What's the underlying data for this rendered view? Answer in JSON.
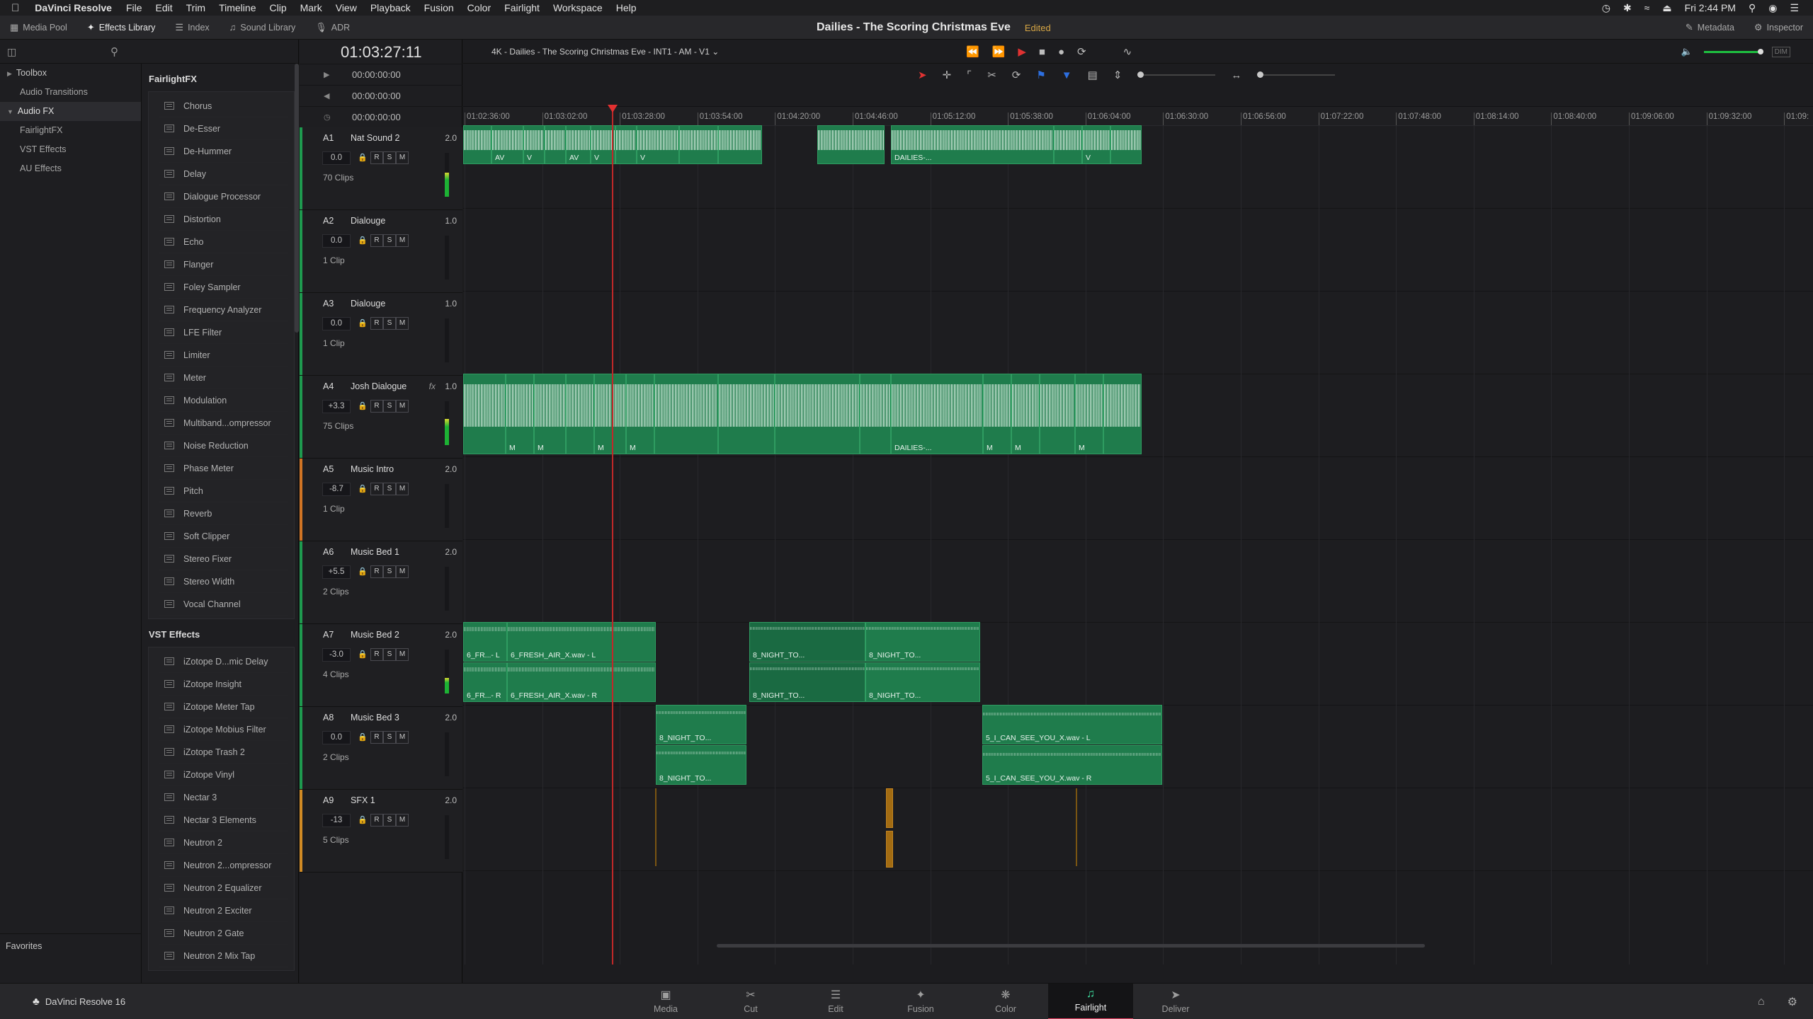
{
  "menubar": {
    "app_name": "DaVinci Resolve",
    "items": [
      "File",
      "Edit",
      "Trim",
      "Timeline",
      "Clip",
      "Mark",
      "View",
      "Playback",
      "Fusion",
      "Color",
      "Fairlight",
      "Workspace",
      "Help"
    ],
    "clock": "Fri 2:44 PM"
  },
  "topbar": {
    "media_pool": "Media Pool",
    "effects_library": "Effects Library",
    "index": "Index",
    "sound_library": "Sound Library",
    "adr": "ADR",
    "project_name": "Dailies - The Scoring Christmas Eve",
    "status": "Edited",
    "metadata": "Metadata",
    "inspector": "Inspector"
  },
  "tree": {
    "toolbox": "Toolbox",
    "audio_transitions": "Audio Transitions",
    "audio_fx": "Audio FX",
    "fairlight_fx": "FairlightFX",
    "vst_effects": "VST Effects",
    "au_effects": "AU Effects",
    "favorites": "Favorites"
  },
  "fairlight_section": "FairlightFX",
  "fairlight_fx": [
    "Chorus",
    "De-Esser",
    "De-Hummer",
    "Delay",
    "Dialogue Processor",
    "Distortion",
    "Echo",
    "Flanger",
    "Foley Sampler",
    "Frequency Analyzer",
    "LFE Filter",
    "Limiter",
    "Meter",
    "Modulation",
    "Multiband...ompressor",
    "Noise Reduction",
    "Phase Meter",
    "Pitch",
    "Reverb",
    "Soft Clipper",
    "Stereo Fixer",
    "Stereo Width",
    "Vocal Channel"
  ],
  "vst_section": "VST Effects",
  "vst_fx": [
    "iZotope D...mic Delay",
    "iZotope Insight",
    "iZotope Meter Tap",
    "iZotope Mobius Filter",
    "iZotope Trash 2",
    "iZotope Vinyl",
    "Nectar 3",
    "Nectar 3 Elements",
    "Neutron 2",
    "Neutron 2...ompressor",
    "Neutron 2 Equalizer",
    "Neutron 2 Exciter",
    "Neutron 2 Gate",
    "Neutron 2 Mix Tap"
  ],
  "timecode": {
    "current": "01:03:27:11",
    "in": "00:00:00:00",
    "out": "00:00:00:00",
    "duration": "00:00:00:00"
  },
  "timeline": {
    "title": "4K - Dailies - The Scoring Christmas Eve - INT1 - AM - V1",
    "ruler": [
      "01:02:36:00",
      "01:03:02:00",
      "01:03:28:00",
      "01:03:54:00",
      "01:04:20:00",
      "01:04:46:00",
      "01:05:12:00",
      "01:05:38:00",
      "01:06:04:00",
      "01:06:30:00",
      "01:06:56:00",
      "01:07:22:00",
      "01:07:48:00",
      "01:08:14:00",
      "01:08:40:00",
      "01:09:06:00",
      "01:09:32:00",
      "01:09:"
    ]
  },
  "tracks": [
    {
      "id": "A1",
      "name": "Nat Sound 2",
      "chan": "2.0",
      "vol": "0.0",
      "clips": "70 Clips",
      "fx": "",
      "color": "#1e9a4f",
      "meter": 0.55
    },
    {
      "id": "A2",
      "name": "Dialouge",
      "chan": "1.0",
      "vol": "0.0",
      "clips": "1 Clip",
      "fx": "",
      "color": "#1e9a4f",
      "meter": 0
    },
    {
      "id": "A3",
      "name": "Dialouge",
      "chan": "1.0",
      "vol": "0.0",
      "clips": "1 Clip",
      "fx": "",
      "color": "#1e9a4f",
      "meter": 0
    },
    {
      "id": "A4",
      "name": "Josh Dialogue",
      "chan": "1.0",
      "vol": "+3.3",
      "clips": "75 Clips",
      "fx": "fx",
      "color": "#1e9a4f",
      "meter": 0.6
    },
    {
      "id": "A5",
      "name": "Music Intro",
      "chan": "2.0",
      "vol": "-8.7",
      "clips": "1 Clip",
      "fx": "",
      "color": "#d07424",
      "meter": 0
    },
    {
      "id": "A6",
      "name": "Music Bed 1",
      "chan": "2.0",
      "vol": "+5.5",
      "clips": "2 Clips",
      "fx": "",
      "color": "#1e9a4f",
      "meter": 0
    },
    {
      "id": "A7",
      "name": "Music Bed 2",
      "chan": "2.0",
      "vol": "-3.0",
      "clips": "4 Clips",
      "fx": "",
      "color": "#1e9a4f",
      "meter": 0.35
    },
    {
      "id": "A8",
      "name": "Music Bed 3",
      "chan": "2.0",
      "vol": "0.0",
      "clips": "2 Clips",
      "fx": "",
      "color": "#1e9a4f",
      "meter": 0
    },
    {
      "id": "A9",
      "name": "SFX 1",
      "chan": "2.0",
      "vol": "-13",
      "clips": "5 Clips",
      "fx": "",
      "color": "#d08a24",
      "meter": 0
    }
  ],
  "track_buttons": {
    "r": "R",
    "s": "S",
    "m": "M"
  },
  "clip_labels": {
    "a1": [
      "AV",
      "V",
      "AV",
      "V",
      "V",
      "DAILIES-...",
      "V"
    ],
    "a4": [
      "M",
      "M",
      "M",
      "M",
      "DAILIES-...",
      "M",
      "M",
      "M"
    ],
    "a7_l1": "6_FR...- L",
    "a7_l2": "6_FRESH_AIR_X.wav - L",
    "a7_r1": "6_FR...- R",
    "a7_r2": "6_FRESH_AIR_X.wav - R",
    "night": "8_NIGHT_TO...",
    "see_l": "5_I_CAN_SEE_YOU_X.wav - L",
    "see_r": "5_I_CAN_SEE_YOU_X.wav - R"
  },
  "pages": [
    "Media",
    "Cut",
    "Edit",
    "Fusion",
    "Color",
    "Fairlight",
    "Deliver"
  ],
  "brand": "DaVinci Resolve 16"
}
